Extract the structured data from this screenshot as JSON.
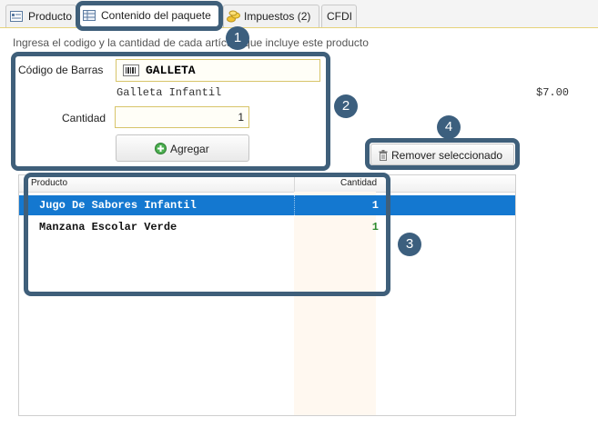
{
  "tabs": [
    {
      "label": "Producto",
      "icon": "product-card-icon"
    },
    {
      "label": "Contenido del paquete",
      "icon": "package-grid-icon"
    },
    {
      "label": "Impuestos (2)",
      "icon": "coins-icon"
    },
    {
      "label": "CFDI"
    }
  ],
  "instructions": "Ingresa el codigo y la cantidad de cada artículo que incluye este producto",
  "form": {
    "barcode_label": "Código de Barras",
    "barcode_value": "GALLETA",
    "barcode_icon": "barcode-icon",
    "product_name": "Galleta Infantil",
    "price": "$7.00",
    "quantity_label": "Cantidad",
    "quantity_value": "1",
    "add_button": "Agregar",
    "add_icon": "plus-circle-icon"
  },
  "remove_button": {
    "label": "Remover seleccionado",
    "icon": "trash-icon"
  },
  "grid": {
    "headers": [
      "Producto",
      "Cantidad"
    ],
    "rows": [
      {
        "product": "Jugo De Sabores Infantil",
        "qty": "1",
        "selected": true
      },
      {
        "product": "Manzana Escolar Verde",
        "qty": "1",
        "selected": false
      }
    ]
  },
  "callouts": [
    "1",
    "2",
    "3",
    "4"
  ],
  "colors": {
    "callout": "#3f5f7a",
    "selection": "#1478d0",
    "qty_green": "#2e8b2e"
  }
}
